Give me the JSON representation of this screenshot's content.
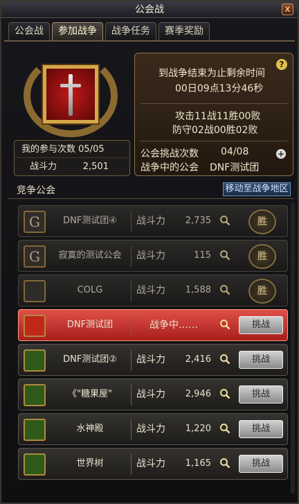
{
  "window": {
    "title": "公会战",
    "close_label": "x"
  },
  "tabs": [
    {
      "label": "公会战",
      "active": false
    },
    {
      "label": "参加战争",
      "active": true
    },
    {
      "label": "战争任务",
      "active": false
    },
    {
      "label": "赛季奖励",
      "active": false
    }
  ],
  "my_stats": {
    "participation_label": "我的参与次数",
    "participation_value": "05/05",
    "power_label": "战斗力",
    "power_value": "2,501"
  },
  "info": {
    "help_label": "?",
    "countdown_title": "到战争结束为止剩余时间",
    "countdown_value": "00日09点13分46秒",
    "attack_record": "攻击11战11胜00败",
    "defense_record": "防守02战00胜02败",
    "challenge_count_label": "公会挑战次数",
    "challenge_count_value": "04/08",
    "at_war_label": "战争中的公会",
    "at_war_value": "DNF测试团",
    "plus_label": "+"
  },
  "compete": {
    "label": "竞争公会",
    "move_button": "移动至战争地区"
  },
  "guilds": [
    {
      "icon": "G",
      "name": "DNF测试团④",
      "power_label": "战斗力",
      "power": "2,735",
      "state": "defeated",
      "action": "胜"
    },
    {
      "icon": "G",
      "name": "寂寞的测试公会",
      "power_label": "战斗力",
      "power": "115",
      "state": "defeated",
      "action": "胜"
    },
    {
      "icon": "",
      "name": "COLG",
      "power_label": "战斗力",
      "power": "1,588",
      "state": "defeated",
      "action": "胜"
    },
    {
      "icon": "",
      "name": "DNF测试团",
      "status": "战争中……",
      "state": "current",
      "action": "挑战"
    },
    {
      "icon": "",
      "name": "DNF测试团②",
      "power_label": "战斗力",
      "power": "2,416",
      "state": "normal",
      "action": "挑战"
    },
    {
      "icon": "",
      "name": "《\"糖果屋\"",
      "power_label": "战斗力",
      "power": "2,946",
      "state": "normal",
      "action": "挑战"
    },
    {
      "icon": "",
      "name": "水神殿",
      "power_label": "战斗力",
      "power": "1,220",
      "state": "normal",
      "action": "挑战"
    },
    {
      "icon": "",
      "name": "世界树",
      "power_label": "战斗力",
      "power": "1,165",
      "state": "normal",
      "action": "挑战"
    }
  ]
}
